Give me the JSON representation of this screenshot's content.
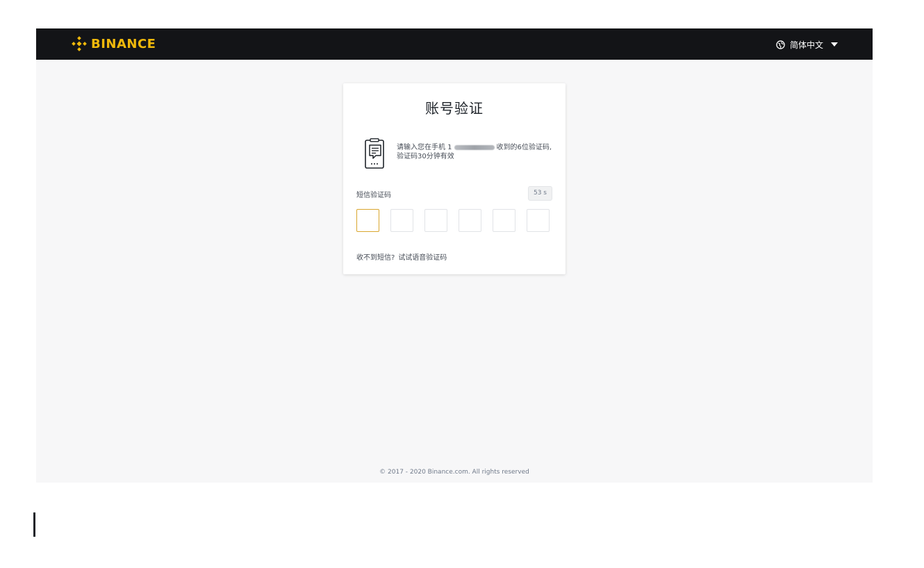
{
  "header": {
    "brand": "BINANCE",
    "brand_color": "#f0b90b",
    "language": "简体中文",
    "language_icon": "globe-icon",
    "language_menu_icon": "caret-down-icon"
  },
  "card": {
    "title": "账号验证",
    "icon": "sms-phone-icon",
    "instruction_before": "请输入您在手机 1",
    "instruction_after": "收到的6位验证码,",
    "instruction_line2": "验证码30分钟有效",
    "field_label": "短信验证码",
    "countdown": "53 s",
    "code_digits": [
      "",
      "",
      "",
      "",
      "",
      ""
    ],
    "help_question": "收不到短信?",
    "help_link": "试试语音验证码",
    "active_border_color": "#d9a62e"
  },
  "footer": {
    "copyright": "© 2017 - 2020 Binance.com. All rights reserved"
  }
}
